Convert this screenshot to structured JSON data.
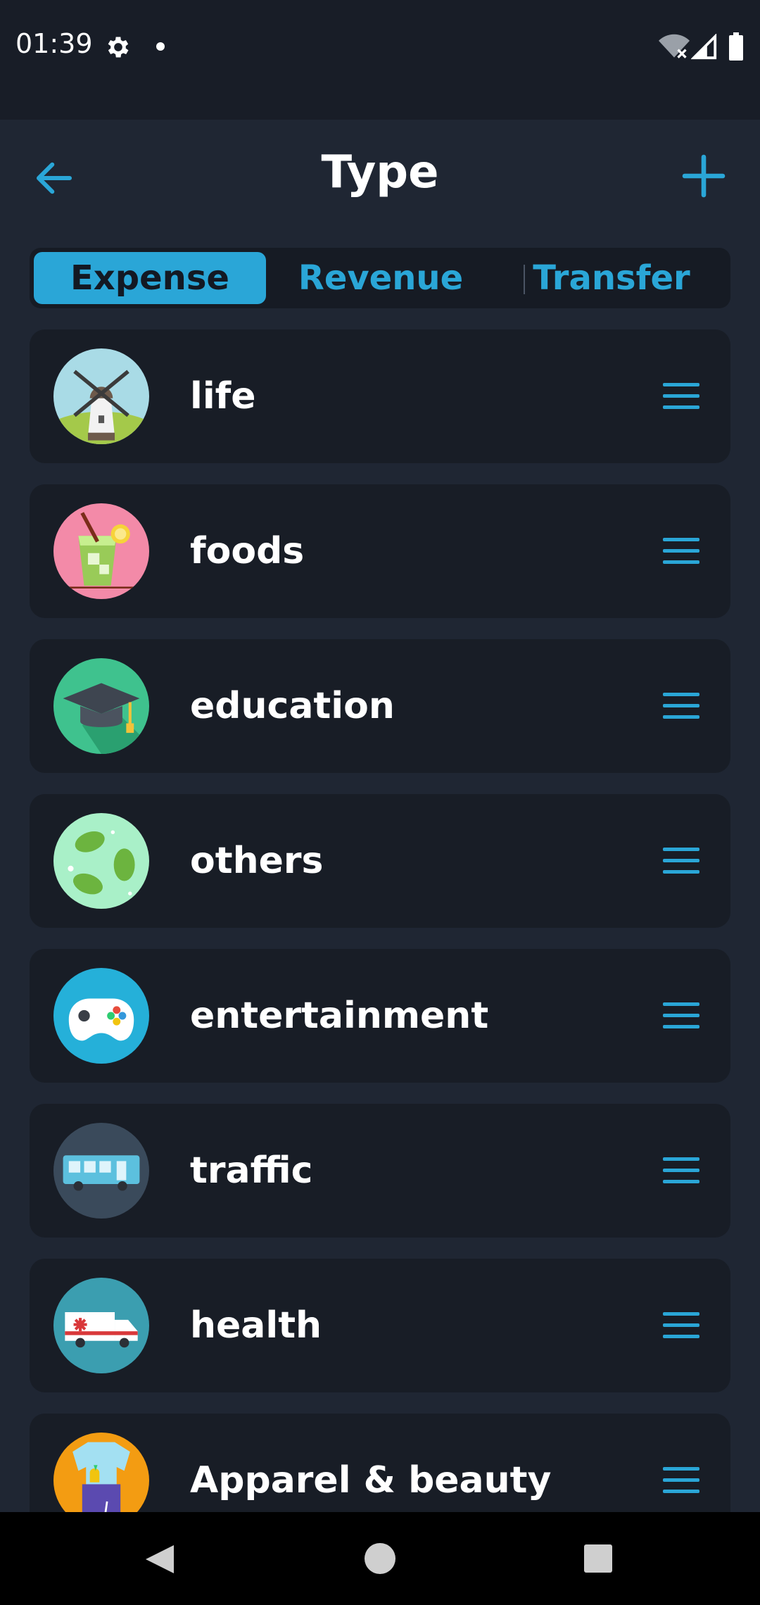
{
  "status_bar": {
    "time": "01:39",
    "icons": [
      "gear-icon",
      "notification-dot",
      "wifi-off-icon",
      "signal-icon",
      "battery-icon"
    ]
  },
  "header": {
    "title": "Type",
    "back_icon": "arrow-left-icon",
    "add_icon": "plus-icon"
  },
  "tabs": [
    {
      "label": "Expense",
      "active": true
    },
    {
      "label": "Revenue",
      "active": false
    },
    {
      "label": "Transfer",
      "active": false
    }
  ],
  "categories": [
    {
      "label": "life",
      "icon": "windmill-icon"
    },
    {
      "label": "foods",
      "icon": "drink-icon"
    },
    {
      "label": "education",
      "icon": "graduation-cap-icon"
    },
    {
      "label": "others",
      "icon": "leaves-icon"
    },
    {
      "label": "entertainment",
      "icon": "gamepad-icon"
    },
    {
      "label": "traffic",
      "icon": "bus-icon"
    },
    {
      "label": "health",
      "icon": "ambulance-icon"
    },
    {
      "label": "Apparel & beauty",
      "icon": "apparel-icon"
    }
  ],
  "colors": {
    "background": "#1f2633",
    "card": "#181d26",
    "accent": "#2aa6d7",
    "text": "#ffffff"
  }
}
